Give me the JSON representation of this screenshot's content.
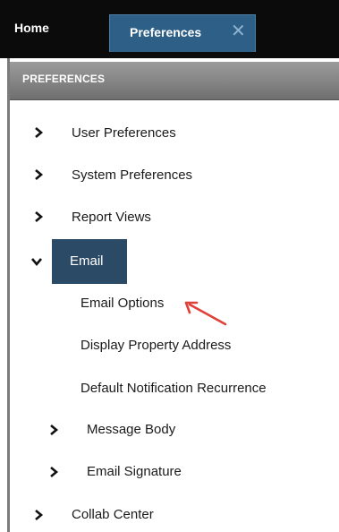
{
  "tabs": {
    "home": "Home",
    "preferences": "Preferences",
    "close_symbol": "✕"
  },
  "panel": {
    "title": "PREFERENCES"
  },
  "menu": {
    "user_preferences": "User Preferences",
    "system_preferences": "System Preferences",
    "report_views": "Report Views",
    "email": "Email",
    "email_options": "Email Options",
    "display_property_address": "Display Property Address",
    "default_notification_recurrence": "Default Notification Recurrence",
    "message_body": "Message Body",
    "email_signature": "Email Signature",
    "collab_center": "Collab Center"
  },
  "colors": {
    "top_bar": "#0b0b0b",
    "active_tab": "#2e5f87",
    "panel_header": "#8a8a8a",
    "email_selected": "#2b4a66",
    "annotation_arrow": "#e0403a"
  }
}
